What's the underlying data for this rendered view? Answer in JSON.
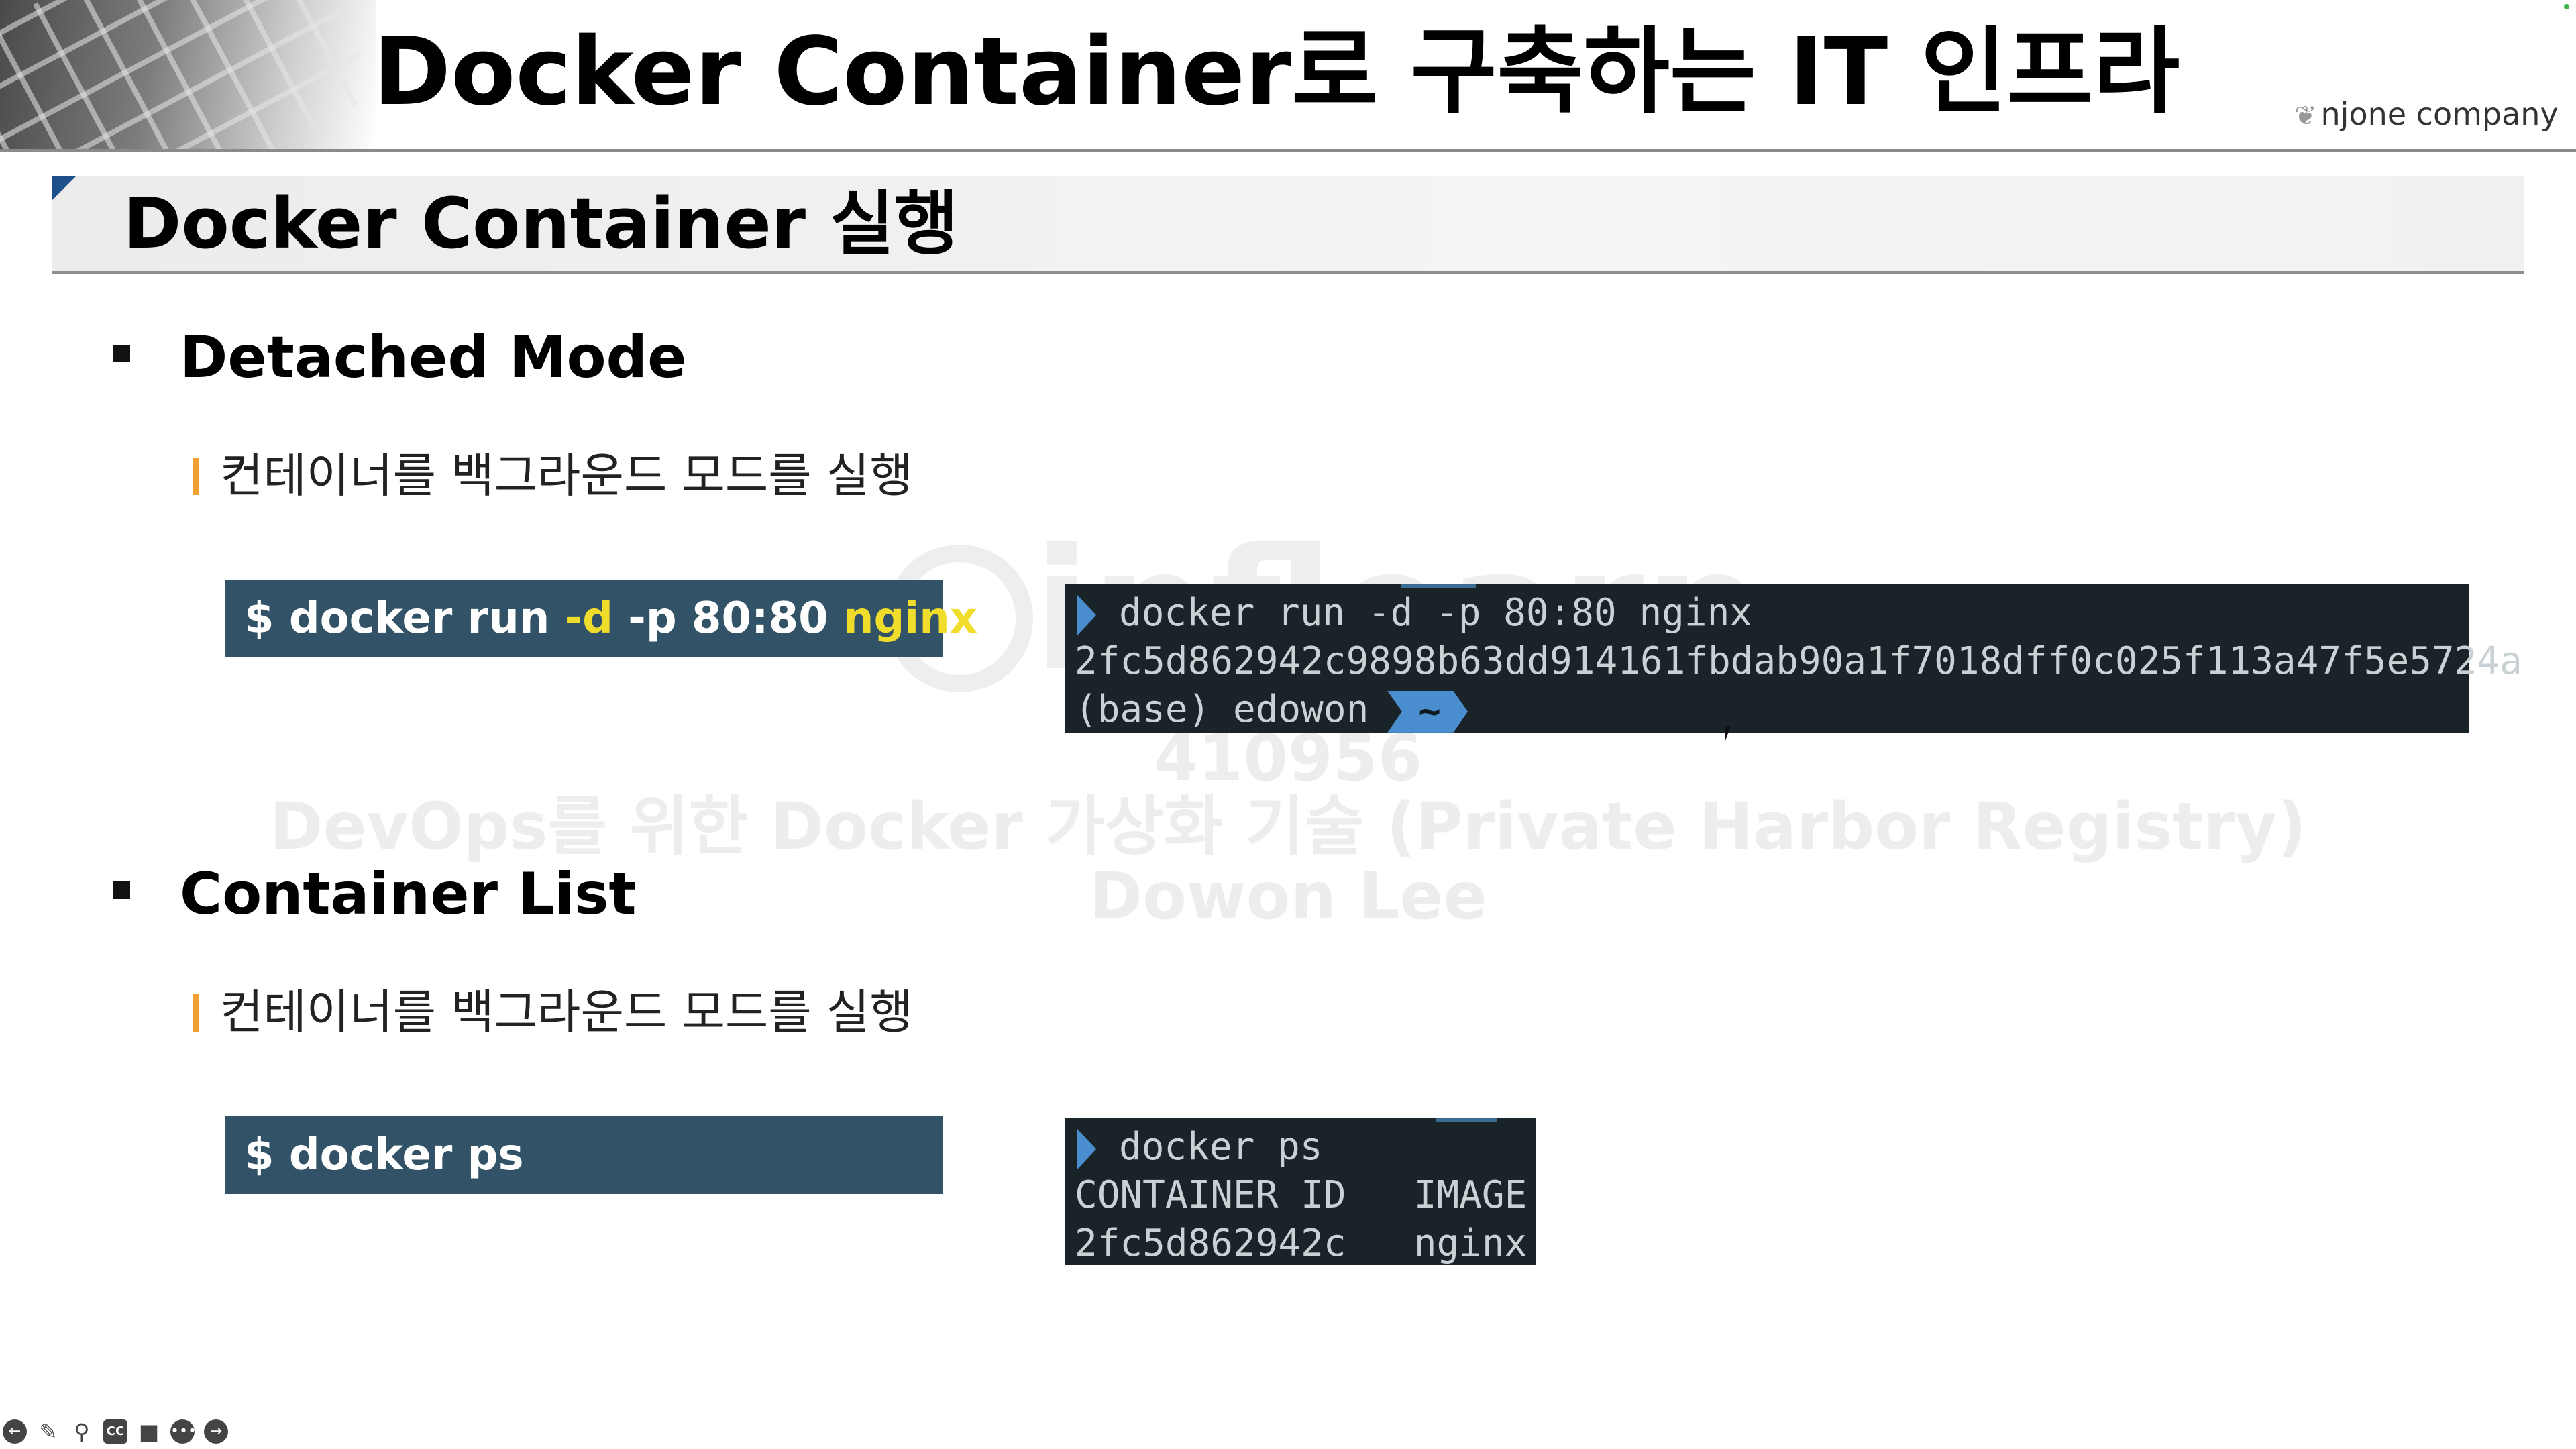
{
  "header": {
    "title": "Docker Container로 구축하는 IT 인프라",
    "brand": "njone company",
    "brand_icon": "leaf-icon"
  },
  "section": {
    "title": "Docker Container 실행"
  },
  "bullets": [
    {
      "heading": "Detached Mode",
      "subtext": "컨테이너를 백그라운드 모드를 실행",
      "command": {
        "prompt": "$ docker run ",
        "flag1": "-d",
        "middle": " -p 80:80 ",
        "image": "nginx"
      },
      "terminal": [
        "docker run -d -p 80:80 nginx",
        "2fc5d862942c9898b63dd914161fbdab90a1f7018dff0c025f113a47f5e5724a",
        "(base)  edowon",
        "~"
      ]
    },
    {
      "heading": "Container List",
      "subtext": "컨테이너를 백그라운드 모드를 실행",
      "command": {
        "text": "$ docker ps"
      },
      "terminal": [
        "docker ps",
        "CONTAINER ID   IMAGE",
        "2fc5d862942c   nginx"
      ]
    }
  ],
  "watermark": {
    "logo": "inflearn",
    "id": "410956",
    "course": "DevOps를 위한 Docker 가상화 기술 (Private Harbor Registry)",
    "author": "Dowon Lee"
  },
  "toolbar": {
    "icons": [
      "back-icon",
      "pen-icon",
      "zoom-icon",
      "cc-icon",
      "camera-icon",
      "more-icon",
      "forward-icon"
    ],
    "cc_label": "CC"
  },
  "colors": {
    "command_bg": "#325367",
    "highlight": "#f0dc2a",
    "terminal_bg": "#1a2428",
    "accent_blue": "#4a8ed0",
    "sub_bar": "#f0a030"
  }
}
